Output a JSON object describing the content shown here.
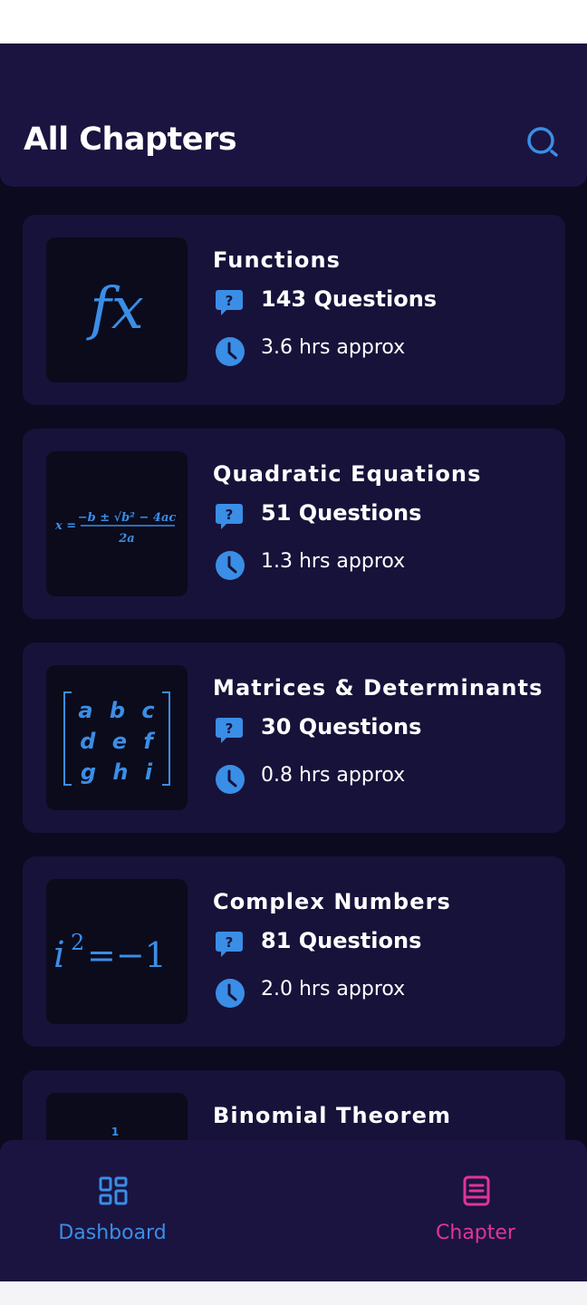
{
  "header": {
    "title": "All Chapters",
    "search_icon": "search-icon"
  },
  "colors": {
    "background": "#0b0a1f",
    "header": "#1b1440",
    "card": "#17123a",
    "accent_blue": "#3a8ee6",
    "accent_pink": "#e0359a"
  },
  "chapters": [
    {
      "title": "Functions",
      "questions": "143 Questions",
      "time": "3.6 hrs approx",
      "thumb_icon": "fx-icon"
    },
    {
      "title": "Quadratic Equations",
      "questions": "51 Questions",
      "time": "1.3 hrs approx",
      "thumb_icon": "quadratic-formula-icon"
    },
    {
      "title": "Matrices & Determinants",
      "questions": "30 Questions",
      "time": "0.8 hrs approx",
      "thumb_icon": "matrix-icon"
    },
    {
      "title": "Complex Numbers",
      "questions": "81 Questions",
      "time": "2.0 hrs approx",
      "thumb_icon": "imaginary-unit-icon"
    },
    {
      "title": "Binomial Theorem",
      "thumb_icon": "pascal-triangle-icon"
    }
  ],
  "thumbs": {
    "fx": "fx",
    "quadratic": {
      "lhs": "x =",
      "numerator": "−b ± √b² − 4ac",
      "denominator": "2a"
    },
    "matrix": {
      "rows": [
        "a b c",
        "d e f",
        "g h i"
      ]
    },
    "complex": {
      "base": "i",
      "power": "2",
      "rhs": "=−1"
    },
    "binomial": {
      "top": "1"
    }
  },
  "nav": [
    {
      "label": "Dashboard",
      "icon": "dashboard-grid-icon",
      "active": false
    },
    {
      "label": "Chapter",
      "icon": "book-icon",
      "active": true
    }
  ]
}
